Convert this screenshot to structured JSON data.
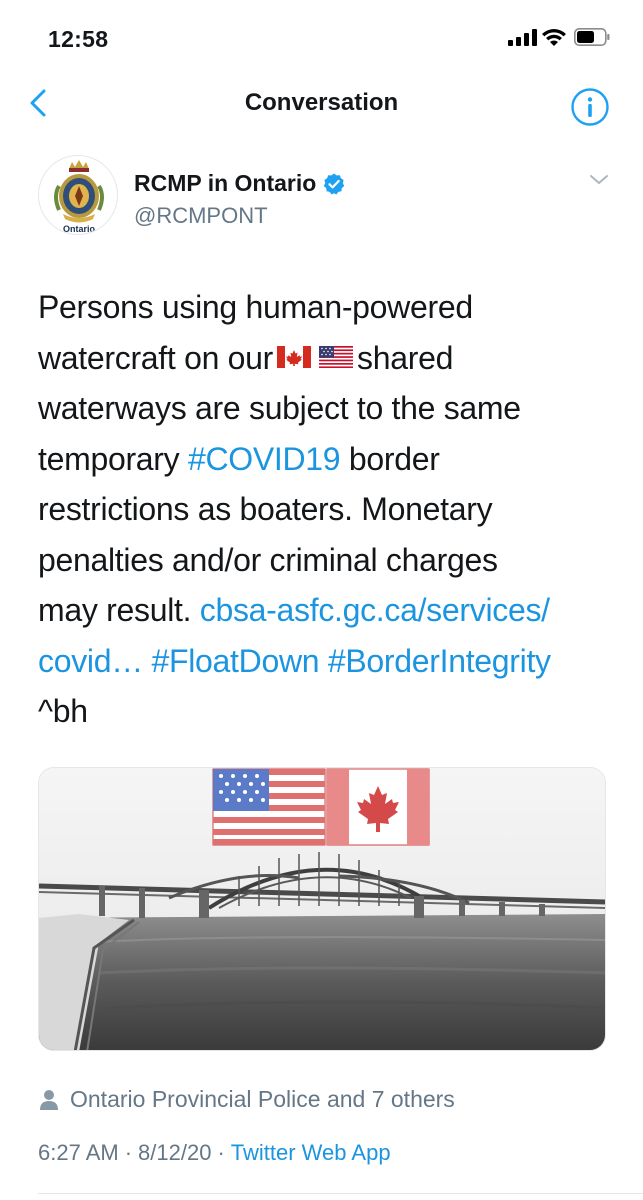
{
  "status_bar": {
    "time": "12:58"
  },
  "nav": {
    "title": "Conversation",
    "back_icon": "chevron-left-icon",
    "info_icon": "info-icon"
  },
  "author": {
    "name": "RCMP in Ontario",
    "handle": "@RCMPONT",
    "verified": true,
    "avatar_caption": "Ontario"
  },
  "tweet": {
    "lines": [
      [
        {
          "text": "Persons using human-powered",
          "type": "text"
        }
      ],
      [
        {
          "text": "watercraft on our",
          "type": "text"
        },
        {
          "type": "flag",
          "flag": "ca"
        },
        {
          "type": "flag",
          "flag": "us"
        },
        {
          "text": "shared",
          "type": "text"
        }
      ],
      [
        {
          "text": "waterways are subject to the same",
          "type": "text"
        }
      ],
      [
        {
          "text": "temporary ",
          "type": "text"
        },
        {
          "text": "#COVID19",
          "type": "link"
        },
        {
          "text": " border",
          "type": "text"
        }
      ],
      [
        {
          "text": "restrictions as boaters. Monetary",
          "type": "text"
        }
      ],
      [
        {
          "text": "penalties and/or criminal charges",
          "type": "text"
        }
      ],
      [
        {
          "text": "may result. ",
          "type": "text"
        },
        {
          "text": "cbsa-asfc.gc.ca/services/",
          "type": "link"
        }
      ],
      [
        {
          "text": "covid…",
          "type": "link"
        },
        {
          "text": " ",
          "type": "text"
        },
        {
          "text": "#FloatDown",
          "type": "link"
        },
        {
          "text": " ",
          "type": "text"
        },
        {
          "text": "#BorderIntegrity",
          "type": "link"
        }
      ],
      [
        {
          "text": "^bh",
          "type": "text"
        }
      ]
    ],
    "link_color": "#1b95e0"
  },
  "social": {
    "likers_text": "Ontario Provincial Police and 7 others"
  },
  "meta": {
    "time": "6:27 AM",
    "separator": "·",
    "date": "8/12/20",
    "source": "Twitter Web App"
  }
}
